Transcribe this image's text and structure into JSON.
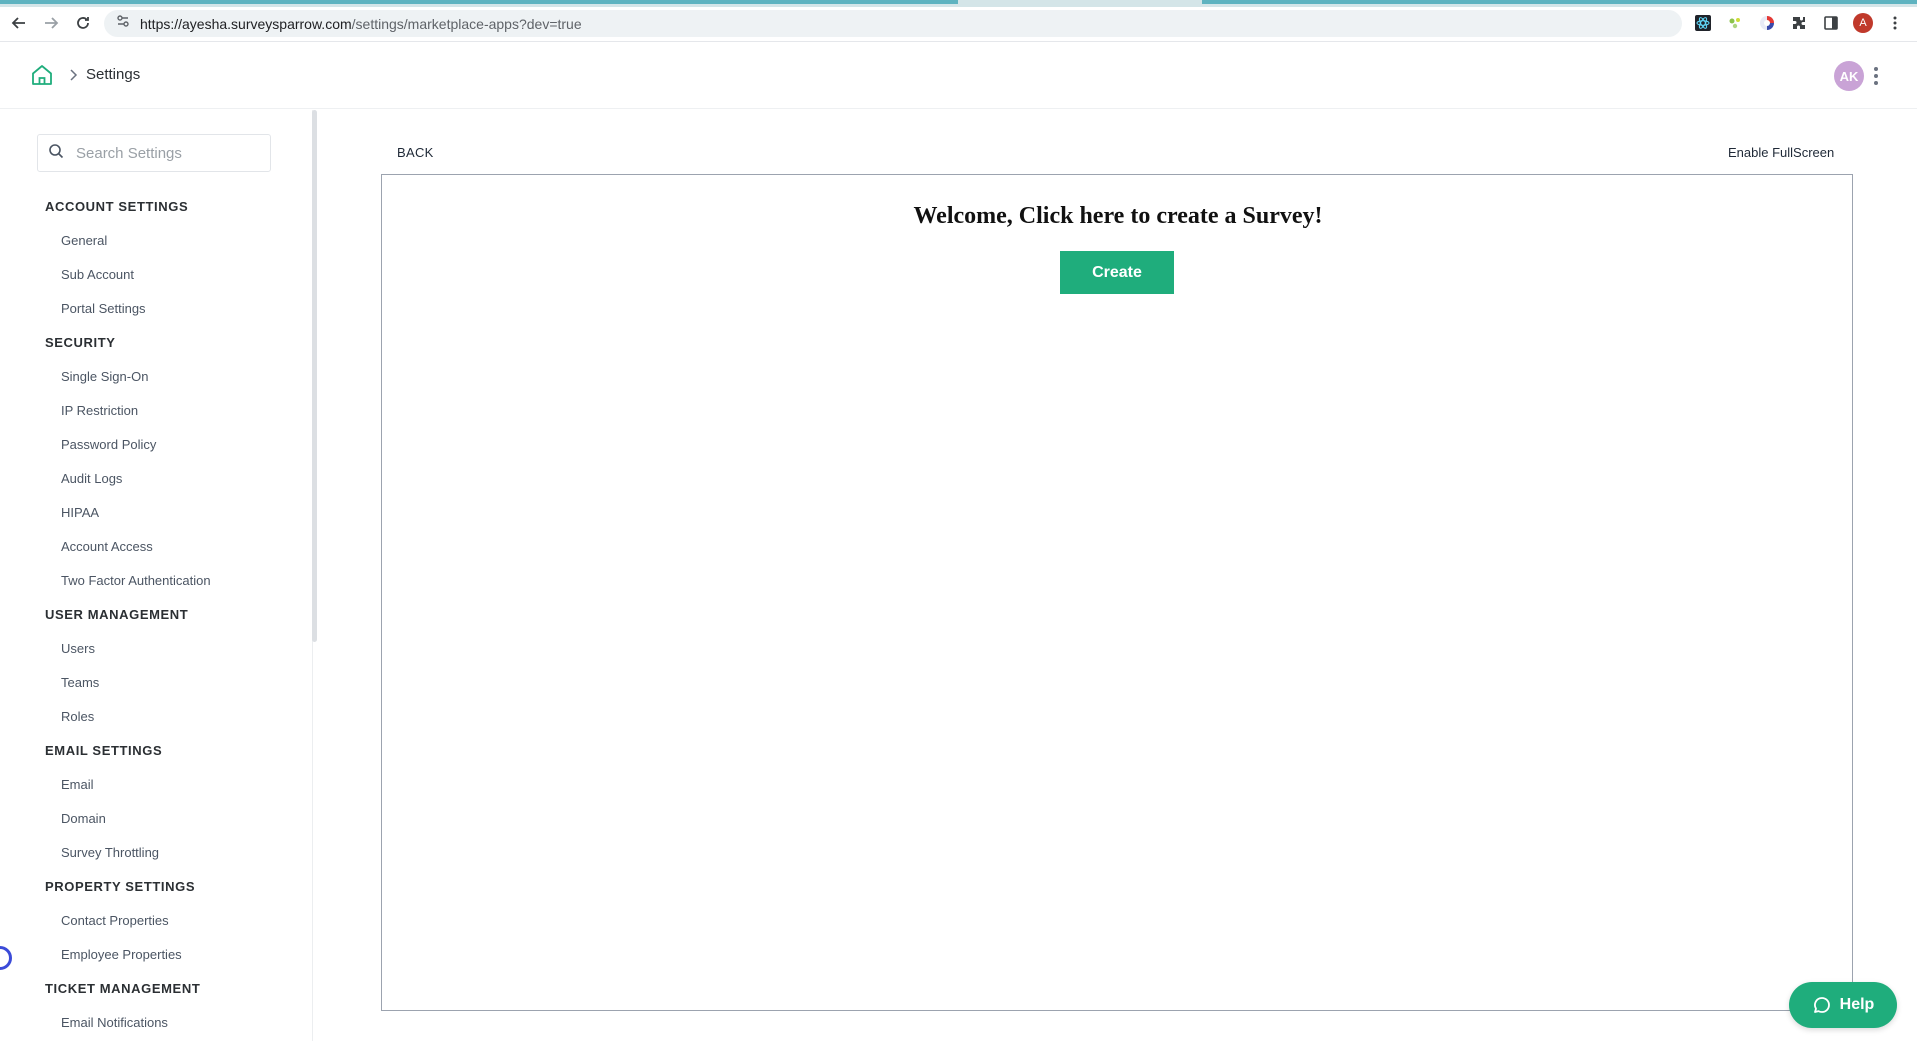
{
  "browser": {
    "url_host": "https://ayesha.surveysparrow.com",
    "url_path": "/settings/marketplace-apps?dev=true",
    "profile_initial": "A"
  },
  "header": {
    "breadcrumb_label": "Settings",
    "avatar_initials": "AK"
  },
  "sidebar": {
    "search_placeholder": "Search Settings",
    "sections": [
      {
        "title": "ACCOUNT SETTINGS",
        "items": [
          "General",
          "Sub Account",
          "Portal Settings"
        ]
      },
      {
        "title": "SECURITY",
        "items": [
          "Single Sign-On",
          "IP Restriction",
          "Password Policy",
          "Audit Logs",
          "HIPAA",
          "Account Access",
          "Two Factor Authentication"
        ]
      },
      {
        "title": "USER MANAGEMENT",
        "items": [
          "Users",
          "Teams",
          "Roles"
        ]
      },
      {
        "title": "EMAIL SETTINGS",
        "items": [
          "Email",
          "Domain",
          "Survey Throttling"
        ]
      },
      {
        "title": "PROPERTY SETTINGS",
        "items": [
          "Contact Properties",
          "Employee Properties"
        ]
      },
      {
        "title": "TICKET MANAGEMENT",
        "items": [
          "Email Notifications"
        ]
      }
    ]
  },
  "main": {
    "back_label": "BACK",
    "fullscreen_label": "Enable FullScreen",
    "welcome_text": "Welcome, Click here to create a Survey!",
    "create_label": "Create"
  },
  "help": {
    "label": "Help"
  },
  "colors": {
    "accent": "#1fad7c",
    "avatar": "#c9a3d6"
  }
}
